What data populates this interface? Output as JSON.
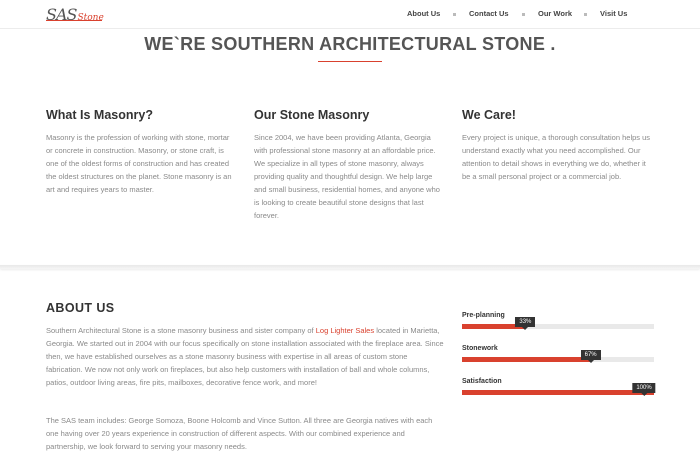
{
  "header": {
    "logo_main": "SAS",
    "logo_sub": "Stone",
    "nav": [
      {
        "label": "About Us"
      },
      {
        "label": "Contact Us"
      },
      {
        "label": "Our Work"
      },
      {
        "label": "Visit Us"
      }
    ]
  },
  "hero": {
    "title": "WE`RE SOUTHERN ARCHITECTURAL STONE ."
  },
  "columns": [
    {
      "heading": "What Is Masonry?",
      "text": "Masonry is the profession of working with stone, mortar or concrete in construction. Masonry, or stone craft, is one of the oldest forms of construction and has created the oldest structures on the planet. Stone masonry is an art and requires years to master."
    },
    {
      "heading": "Our Stone Masonry",
      "text": "Since 2004, we have been providing Atlanta, Georgia with professional stone masonry at an affordable price. We specialize in all types of stone masonry, always providing quality and thoughtful design. We help large and small business, residential homes, and anyone who is looking to create beautiful stone designs that last forever."
    },
    {
      "heading": "We Care!",
      "text": "Every project is unique, a thorough consultation helps us understand exactly what you need accomplished. Our attention to detail shows in everything we do, whether it be a small personal project or a commercial job."
    }
  ],
  "about": {
    "title": "ABOUT US",
    "p1_before": "Southern Architectural Stone is a stone masonry business and sister company of ",
    "p1_link": "Log Lighter Sales",
    "p1_after": " located in Marietta, Georgia. We started out in 2004 with our focus specifically on stone installation associated with the fireplace area. Since then, we have established ourselves as a stone masonry business with expertise in all areas of custom stone fabrication. We now not only work on fireplaces, but also help customers with installation of ball and whole columns, patios, outdoor living areas, fire pits, mailboxes, decorative fence work, and more!",
    "p2": "The SAS team includes: George Somoza, Boone Holcomb and Vince Sutton. All three are Georgia natives with each one having over 20 years experience in construction of different aspects. With our combined experience and partnership, we look forward to serving your masonry needs."
  },
  "skills": [
    {
      "label": "Pre-planning",
      "percent_text": "33%",
      "value": 0.33
    },
    {
      "label": "Stonework",
      "percent_text": "67%",
      "value": 0.67
    },
    {
      "label": "Satisfaction",
      "percent_text": "100%",
      "value": 1.0
    }
  ],
  "colors": {
    "accent": "#d9412e",
    "tooltip": "#333333",
    "track": "#e9e9e9"
  }
}
